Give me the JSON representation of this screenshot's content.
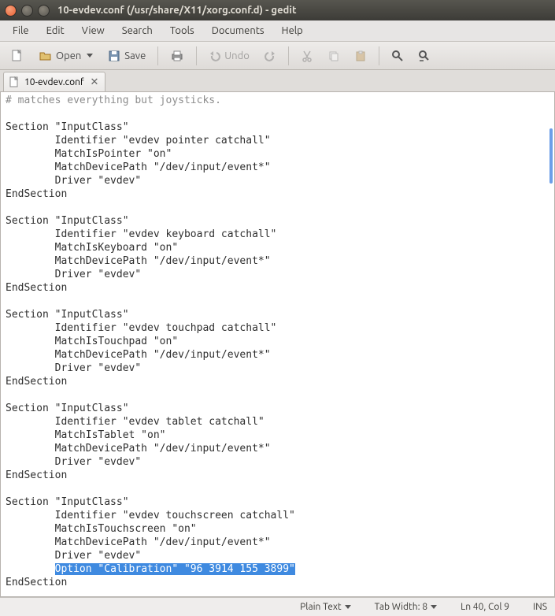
{
  "window": {
    "title": "10-evdev.conf (/usr/share/X11/xorg.conf.d) - gedit"
  },
  "menubar": [
    "File",
    "Edit",
    "View",
    "Search",
    "Tools",
    "Documents",
    "Help"
  ],
  "toolbar": {
    "open_label": "Open",
    "save_label": "Save",
    "undo_label": "Undo"
  },
  "tab": {
    "label": "10-evdev.conf"
  },
  "editor": {
    "line_top": "# matches everything but joysticks.",
    "block1": "Section \"InputClass\"\n        Identifier \"evdev pointer catchall\"\n        MatchIsPointer \"on\"\n        MatchDevicePath \"/dev/input/event*\"\n        Driver \"evdev\"\nEndSection",
    "block2": "Section \"InputClass\"\n        Identifier \"evdev keyboard catchall\"\n        MatchIsKeyboard \"on\"\n        MatchDevicePath \"/dev/input/event*\"\n        Driver \"evdev\"\nEndSection",
    "block3": "Section \"InputClass\"\n        Identifier \"evdev touchpad catchall\"\n        MatchIsTouchpad \"on\"\n        MatchDevicePath \"/dev/input/event*\"\n        Driver \"evdev\"\nEndSection",
    "block4": "Section \"InputClass\"\n        Identifier \"evdev tablet catchall\"\n        MatchIsTablet \"on\"\n        MatchDevicePath \"/dev/input/event*\"\n        Driver \"evdev\"\nEndSection",
    "block5_head": "Section \"InputClass\"\n        Identifier \"evdev touchscreen catchall\"\n        MatchIsTouchscreen \"on\"\n        MatchDevicePath \"/dev/input/event*\"\n        Driver \"evdev\"",
    "block5_sel_prefix": "        ",
    "block5_sel": "Option \"Calibration\" \"96 3914 155 3899\"",
    "block5_tail": "\nEndSection"
  },
  "status": {
    "syntax": "Plain Text",
    "tabwidth": "Tab Width: 8",
    "position": "Ln 40, Col 9",
    "insert": "INS"
  }
}
